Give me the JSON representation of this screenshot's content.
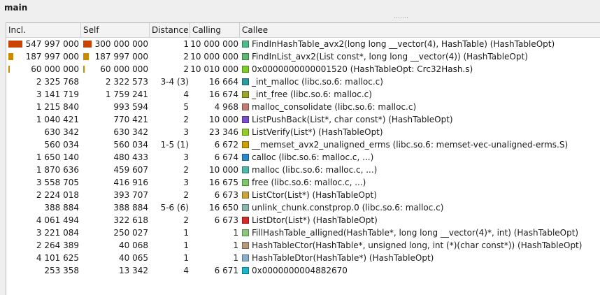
{
  "window": {
    "title": "main"
  },
  "columns": {
    "incl": "Incl.",
    "self": "Self",
    "distance": "Distance",
    "calling": "Calling",
    "callee": "Callee"
  },
  "colors": {
    "bar_fill": "#c84400",
    "bar_fill_light": "#c98a00"
  },
  "rows": [
    {
      "incl": "547 997 000",
      "self": "300 000 000",
      "distance": "1",
      "calling": "10 000 000",
      "callee": "FindInHashTable_avx2(long long __vector(4), HashTable) (HashTableOpt)",
      "incl_bar": 1.0,
      "self_bar": 1.0,
      "color": "#4fba8a"
    },
    {
      "incl": "187 997 000",
      "self": "187 997 000",
      "distance": "2",
      "calling": "10 000 000",
      "callee": "FindInList_avx2(List const*, long long __vector(4)) (HashTableOpt)",
      "incl_bar": 0.34,
      "self_bar": 0.63,
      "color": "#60b870"
    },
    {
      "incl": "60 000 000",
      "self": "60 000 000",
      "distance": "2",
      "calling": "10 010 000",
      "callee": "0x0000000000001520 (HashTableOpt: Crc32Hash.s)",
      "incl_bar": 0.11,
      "self_bar": 0.2,
      "color": "#7fcc2a"
    },
    {
      "incl": "2 325 768",
      "self": "2 322 573",
      "distance": "3-4 (3)",
      "calling": "16 664",
      "callee": "_int_malloc (libc.so.6: malloc.c)",
      "color": "#2e9aa0"
    },
    {
      "incl": "3 141 719",
      "self": "1 759 241",
      "distance": "4",
      "calling": "16 674",
      "callee": "_int_free (libc.so.6: malloc.c)",
      "color": "#9ea52e"
    },
    {
      "incl": "1 215 840",
      "self": "993 594",
      "distance": "5",
      "calling": "4 968",
      "callee": "malloc_consolidate (libc.so.6: malloc.c)",
      "color": "#c27a72"
    },
    {
      "incl": "1 040 421",
      "self": "770 421",
      "distance": "2",
      "calling": "10 000",
      "callee": "ListPushBack(List*, char const*) (HashTableOpt)",
      "color": "#7a4fc8"
    },
    {
      "incl": "630 342",
      "self": "630 342",
      "distance": "3",
      "calling": "23 346",
      "callee": "ListVerify(List*) (HashTableOpt)",
      "color": "#8fcf2a"
    },
    {
      "incl": "560 034",
      "self": "560 034",
      "distance": "1-5 (1)",
      "calling": "6 672",
      "callee": "__memset_avx2_unaligned_erms (libc.so.6: memset-vec-unaligned-erms.S)",
      "color": "#c9a000"
    },
    {
      "incl": "1 650 140",
      "self": "480 433",
      "distance": "3",
      "calling": "6 674",
      "callee": "calloc (libc.so.6: malloc.c, ...)",
      "color": "#2a8ac8"
    },
    {
      "incl": "1 870 636",
      "self": "459 607",
      "distance": "2",
      "calling": "10 000",
      "callee": "malloc (libc.so.6: malloc.c, ...)",
      "color": "#4fb8a8"
    },
    {
      "incl": "3 558 705",
      "self": "416 916",
      "distance": "3",
      "calling": "16 675",
      "callee": "free (libc.so.6: malloc.c, ...)",
      "color": "#7ec86a"
    },
    {
      "incl": "2 224 018",
      "self": "393 707",
      "distance": "2",
      "calling": "6 673",
      "callee": "ListCtor(List*) (HashTableOpt)",
      "color": "#c8a43a"
    },
    {
      "incl": "388 884",
      "self": "388 884",
      "distance": "5-6 (6)",
      "calling": "16 650",
      "callee": "unlink_chunk.constprop.0 (libc.so.6: malloc.c)",
      "color": "#8ab8b0"
    },
    {
      "incl": "4 061 494",
      "self": "322 618",
      "distance": "2",
      "calling": "6 673",
      "callee": "ListDtor(List*) (HashTableOpt)",
      "color": "#d42a2a"
    },
    {
      "incl": "3 221 084",
      "self": "250 027",
      "distance": "1",
      "calling": "1",
      "callee": "FillHashTable_alligned(HashTable*, long long __vector(4)*, int) (HashTableOpt)",
      "color": "#8ac87a"
    },
    {
      "incl": "2 264 389",
      "self": "40 068",
      "distance": "1",
      "calling": "1",
      "callee": "HashTableCtor(HashTable*, unsigned long, int (*)(char const*)) (HashTableOpt)",
      "color": "#b89a7a"
    },
    {
      "incl": "4 101 625",
      "self": "40 065",
      "distance": "1",
      "calling": "1",
      "callee": "HashTableDtor(HashTable*) (HashTableOpt)",
      "color": "#8aaec8"
    },
    {
      "incl": "253 358",
      "self": "13 342",
      "distance": "4",
      "calling": "6 671",
      "callee": "0x0000000004882670",
      "color": "#1ab8c8"
    }
  ]
}
